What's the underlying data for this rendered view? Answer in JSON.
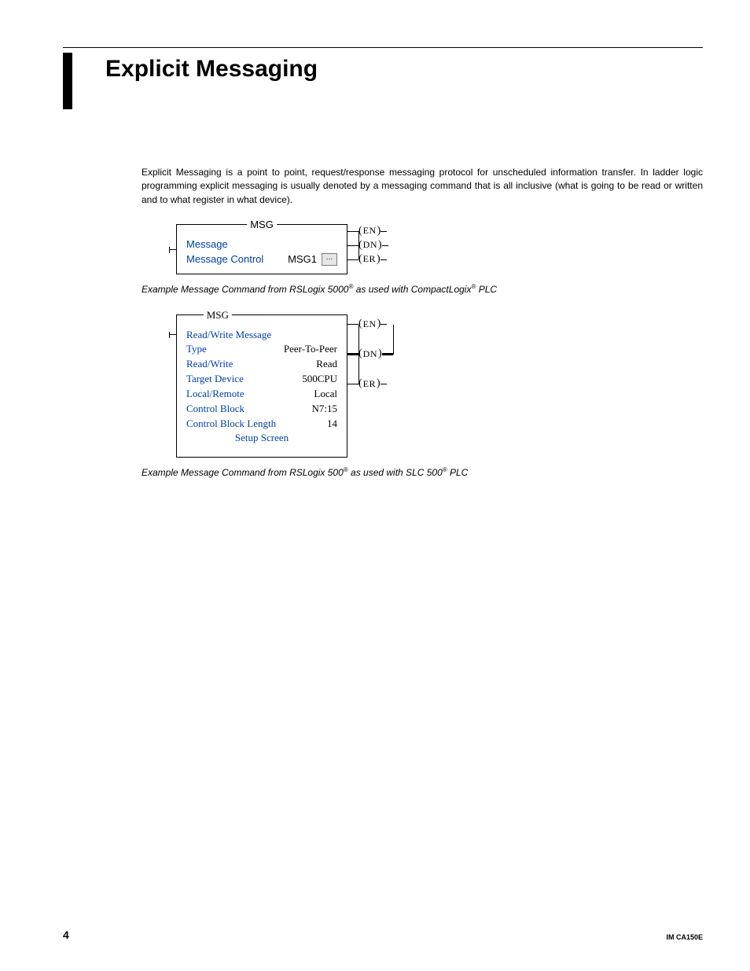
{
  "page": {
    "number": "4",
    "doc_id": "IM CA150E"
  },
  "header": {
    "title": "Explicit Messaging"
  },
  "intro": "Explicit Messaging is a point to point, request/response messaging protocol for unscheduled information transfer.  In ladder logic programming explicit messaging is usually denoted by a messaging command that is all inclusive (what is going to be read or written and to what register in what device).",
  "figure1": {
    "legend": "MSG",
    "rows": {
      "r1_label": "Message",
      "r2_label": "Message Control",
      "r2_value": "MSG1",
      "ellipsis": "..."
    },
    "coils": {
      "en": "EN",
      "dn": "DN",
      "er": "ER"
    },
    "caption_prefix": "Example Message Command from RSLogix 5000",
    "caption_middle": " as used with CompactLogix",
    "caption_suffix": " PLC",
    "reg": "®"
  },
  "figure2": {
    "legend": "MSG",
    "rows": {
      "r1_label": "Read/Write Message",
      "r2_label": "Type",
      "r2_value": "Peer-To-Peer",
      "r3_label": "Read/Write",
      "r3_value": "Read",
      "r4_label": "Target Device",
      "r4_value": "500CPU",
      "r5_label": "Local/Remote",
      "r5_value": "Local",
      "r6_label": "Control Block",
      "r6_value": "N7:15",
      "r7_label": "Control Block Length",
      "r7_value": "14",
      "r8_center": "Setup Screen"
    },
    "coils": {
      "en": "EN",
      "dn": "DN",
      "er": "ER"
    },
    "caption_prefix": "Example Message Command from RSLogix 500",
    "caption_middle": " as used with SLC 500",
    "caption_suffix": " PLC",
    "reg": "®"
  }
}
